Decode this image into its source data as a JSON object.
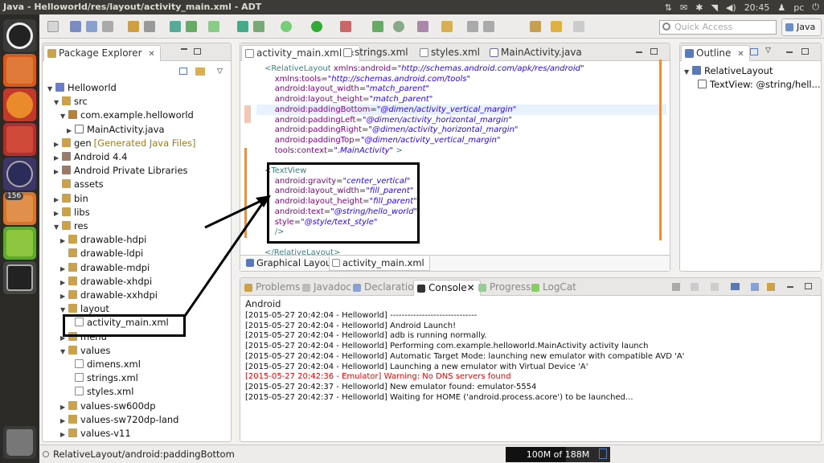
{
  "window": {
    "title": "Java - Helloworld/res/layout/activity_main.xml - ADT"
  },
  "tray": {
    "clock": "20:45",
    "user": "pc"
  },
  "launcher": {
    "badge": "156"
  },
  "toolbar": {
    "quick_access_placeholder": "Quick Access",
    "perspective": "Java"
  },
  "package_explorer": {
    "title": "Package Explorer",
    "tree": [
      {
        "label": "Helloworld",
        "depth": 0,
        "arrow": "open",
        "icon": "proj"
      },
      {
        "label": "src",
        "depth": 1,
        "arrow": "open",
        "icon": "folder"
      },
      {
        "label": "com.example.helloworld",
        "depth": 2,
        "arrow": "open",
        "icon": "pkg"
      },
      {
        "label": "MainActivity.java",
        "depth": 3,
        "arrow": "closed",
        "icon": "java"
      },
      {
        "label": "gen",
        "suffix": "[Generated Java Files]",
        "depth": 1,
        "arrow": "closed",
        "icon": "folder"
      },
      {
        "label": "Android 4.4",
        "depth": 1,
        "arrow": "closed",
        "icon": "lib"
      },
      {
        "label": "Android Private Libraries",
        "depth": 1,
        "arrow": "closed",
        "icon": "lib"
      },
      {
        "label": "assets",
        "depth": 1,
        "arrow": "",
        "icon": "folder"
      },
      {
        "label": "bin",
        "depth": 1,
        "arrow": "closed",
        "icon": "folder"
      },
      {
        "label": "libs",
        "depth": 1,
        "arrow": "closed",
        "icon": "folder"
      },
      {
        "label": "res",
        "depth": 1,
        "arrow": "open",
        "icon": "folder"
      },
      {
        "label": "drawable-hdpi",
        "depth": 2,
        "arrow": "closed",
        "icon": "folder"
      },
      {
        "label": "drawable-ldpi",
        "depth": 2,
        "arrow": "",
        "icon": "folder"
      },
      {
        "label": "drawable-mdpi",
        "depth": 2,
        "arrow": "closed",
        "icon": "folder"
      },
      {
        "label": "drawable-xhdpi",
        "depth": 2,
        "arrow": "closed",
        "icon": "folder"
      },
      {
        "label": "drawable-xxhdpi",
        "depth": 2,
        "arrow": "closed",
        "icon": "folder"
      },
      {
        "label": "layout",
        "depth": 2,
        "arrow": "open",
        "icon": "folder"
      },
      {
        "label": "activity_main.xml",
        "depth": 3,
        "arrow": "",
        "icon": "xmlf"
      },
      {
        "label": "menu",
        "depth": 2,
        "arrow": "closed",
        "icon": "folder"
      },
      {
        "label": "values",
        "depth": 2,
        "arrow": "open",
        "icon": "folder"
      },
      {
        "label": "dimens.xml",
        "depth": 3,
        "arrow": "",
        "icon": "xmlf"
      },
      {
        "label": "strings.xml",
        "depth": 3,
        "arrow": "",
        "icon": "xmlf"
      },
      {
        "label": "styles.xml",
        "depth": 3,
        "arrow": "",
        "icon": "xmlf"
      },
      {
        "label": "values-sw600dp",
        "depth": 2,
        "arrow": "closed",
        "icon": "folder"
      },
      {
        "label": "values-sw720dp-land",
        "depth": 2,
        "arrow": "closed",
        "icon": "folder"
      },
      {
        "label": "values-v11",
        "depth": 2,
        "arrow": "closed",
        "icon": "folder"
      }
    ]
  },
  "editor": {
    "tabs": [
      {
        "label": "activity_main.xml",
        "active": true
      },
      {
        "label": "strings.xml",
        "active": false
      },
      {
        "label": "styles.xml",
        "active": false
      },
      {
        "label": "MainActivity.java",
        "active": false
      }
    ],
    "code": [
      [
        {
          "t": "tag",
          "v": "<RelativeLayout "
        },
        {
          "t": "attr",
          "v": "xmlns:android"
        },
        {
          "t": "plain",
          "v": "="
        },
        {
          "t": "val",
          "v": "\"http://schemas.android.com/apk/res/android\""
        }
      ],
      [
        {
          "t": "attr",
          "v": "    xmlns:tools"
        },
        {
          "t": "plain",
          "v": "="
        },
        {
          "t": "val",
          "v": "\"http://schemas.android.com/tools\""
        }
      ],
      [
        {
          "t": "attr",
          "v": "    android:layout_width"
        },
        {
          "t": "plain",
          "v": "="
        },
        {
          "t": "val",
          "v": "\"match_parent\""
        }
      ],
      [
        {
          "t": "attr",
          "v": "    android:layout_height"
        },
        {
          "t": "plain",
          "v": "="
        },
        {
          "t": "val",
          "v": "\"match_parent\""
        }
      ],
      [
        {
          "t": "attr",
          "v": "    android:paddingBottom"
        },
        {
          "t": "plain",
          "v": "="
        },
        {
          "t": "val",
          "v": "\"@dimen/activity_vertical_margin\""
        }
      ],
      [
        {
          "t": "attr",
          "v": "    android:paddingLeft"
        },
        {
          "t": "plain",
          "v": "="
        },
        {
          "t": "val",
          "v": "\"@dimen/activity_horizontal_margin\""
        }
      ],
      [
        {
          "t": "attr",
          "v": "    android:paddingRight"
        },
        {
          "t": "plain",
          "v": "="
        },
        {
          "t": "val",
          "v": "\"@dimen/activity_horizontal_margin\""
        }
      ],
      [
        {
          "t": "attr",
          "v": "    android:paddingTop"
        },
        {
          "t": "plain",
          "v": "="
        },
        {
          "t": "val",
          "v": "\"@dimen/activity_vertical_margin\""
        }
      ],
      [
        {
          "t": "attr",
          "v": "    tools:context"
        },
        {
          "t": "plain",
          "v": "="
        },
        {
          "t": "val",
          "v": "\".MainActivity\""
        },
        {
          "t": "tag",
          "v": " >"
        }
      ],
      [
        {
          "t": "plain",
          "v": ""
        }
      ],
      [
        {
          "t": "tag",
          "v": "<TextView"
        }
      ],
      [
        {
          "t": "attr",
          "v": "    android:gravity"
        },
        {
          "t": "plain",
          "v": "="
        },
        {
          "t": "val",
          "v": "\"center_vertical\""
        }
      ],
      [
        {
          "t": "attr",
          "v": "    android:layout_width"
        },
        {
          "t": "plain",
          "v": "="
        },
        {
          "t": "val",
          "v": "\"fill_parent\""
        }
      ],
      [
        {
          "t": "attr",
          "v": "    android:layout_height"
        },
        {
          "t": "plain",
          "v": "="
        },
        {
          "t": "val",
          "v": "\"fill_parent\""
        }
      ],
      [
        {
          "t": "attr",
          "v": "    android:text"
        },
        {
          "t": "plain",
          "v": "="
        },
        {
          "t": "val",
          "v": "\"@string/hello_world\""
        }
      ],
      [
        {
          "t": "attr",
          "v": "    style"
        },
        {
          "t": "plain",
          "v": "="
        },
        {
          "t": "val",
          "v": "\"@style/text_style\""
        }
      ],
      [
        {
          "t": "tag",
          "v": "    />"
        }
      ],
      [
        {
          "t": "plain",
          "v": ""
        }
      ],
      [
        {
          "t": "tag",
          "v": "</RelativeLayout>"
        }
      ]
    ],
    "bottom_tabs": [
      {
        "label": "Graphical Layout",
        "active": false
      },
      {
        "label": "activity_main.xml",
        "active": true
      }
    ]
  },
  "outline": {
    "title": "Outline",
    "items": [
      {
        "label": "RelativeLayout",
        "depth": 0
      },
      {
        "label": "TextView: @string/hell...",
        "depth": 1
      }
    ]
  },
  "console": {
    "tabs": [
      {
        "label": "Problems",
        "active": false
      },
      {
        "label": "Javadoc",
        "active": false
      },
      {
        "label": "Declaration",
        "active": false
      },
      {
        "label": "Console",
        "active": true
      },
      {
        "label": "Progress",
        "active": false
      },
      {
        "label": "LogCat",
        "active": false
      }
    ],
    "header": "Android",
    "lines": [
      {
        "text": "[2015-05-27 20:42:04 - Helloworld] ------------------------------",
        "error": false
      },
      {
        "text": "[2015-05-27 20:42:04 - Helloworld] Android Launch!",
        "error": false
      },
      {
        "text": "[2015-05-27 20:42:04 - Helloworld] adb is running normally.",
        "error": false
      },
      {
        "text": "[2015-05-27 20:42:04 - Helloworld] Performing com.example.helloworld.MainActivity activity launch",
        "error": false
      },
      {
        "text": "[2015-05-27 20:42:04 - Helloworld] Automatic Target Mode: launching new emulator with compatible AVD 'A'",
        "error": false
      },
      {
        "text": "[2015-05-27 20:42:04 - Helloworld] Launching a new emulator with Virtual Device 'A'",
        "error": false
      },
      {
        "text": "[2015-05-27 20:42:36 - Emulator] Warning: No DNS servers found",
        "error": true
      },
      {
        "text": "[2015-05-27 20:42:37 - Helloworld] New emulator found: emulator-5554",
        "error": false
      },
      {
        "text": "[2015-05-27 20:42:37 - Helloworld] Waiting for HOME ('android.process.acore') to be launched...",
        "error": false
      }
    ]
  },
  "status": {
    "text": "RelativeLayout/android:paddingBottom",
    "heap": "100M of 188M"
  }
}
